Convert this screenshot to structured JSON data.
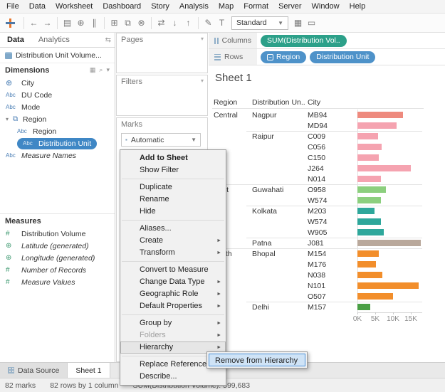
{
  "menu_bar": {
    "items": [
      "File",
      "Data",
      "Worksheet",
      "Dashboard",
      "Story",
      "Analysis",
      "Map",
      "Format",
      "Server",
      "Window",
      "Help"
    ]
  },
  "toolbar": {
    "icons": [
      {
        "name": "back-icon",
        "glyph": "←"
      },
      {
        "name": "forward-icon",
        "glyph": "→"
      },
      {
        "name": "save-icon",
        "glyph": "▤"
      },
      {
        "name": "add-data-source-icon",
        "glyph": "⊕"
      },
      {
        "name": "pause-updates-icon",
        "glyph": "∥"
      },
      {
        "name": "new-worksheet-icon",
        "glyph": "⊞"
      },
      {
        "name": "duplicate-icon",
        "glyph": "⧉"
      },
      {
        "name": "clear-sheet-icon",
        "glyph": "⊗"
      },
      {
        "name": "swap-icon",
        "glyph": "⇄"
      },
      {
        "name": "sort-ascending-icon",
        "glyph": "↓"
      },
      {
        "name": "sort-descending-icon",
        "glyph": "↑"
      },
      {
        "name": "highlight-icon",
        "glyph": "✎"
      },
      {
        "name": "show-labels-icon",
        "glyph": "T"
      }
    ],
    "fit_selector": "Standard",
    "right_icons": [
      {
        "name": "show-me-icon",
        "glyph": "▦"
      },
      {
        "name": "presentation-mode-icon",
        "glyph": "▭"
      }
    ]
  },
  "left_panel": {
    "tabs": [
      {
        "label": "Data"
      },
      {
        "label": "Analytics"
      }
    ],
    "data_source": "Distribution Unit Volume...",
    "dimensions": {
      "header": "Dimensions",
      "items": [
        {
          "icon": "globe",
          "label": "City",
          "indent": 0
        },
        {
          "icon": "abc",
          "label": "DU Code",
          "indent": 0
        },
        {
          "icon": "abc",
          "label": "Mode",
          "indent": 0
        },
        {
          "icon": "hierarchy",
          "label": "Region",
          "indent": 0
        },
        {
          "icon": "abc",
          "label": "Region",
          "indent": 1
        },
        {
          "icon": "abc",
          "label": "Distribution Unit",
          "indent": 1,
          "selected": true
        },
        {
          "icon": "abc",
          "label": "Measure Names",
          "indent": 0,
          "italic": true
        }
      ]
    },
    "measures": {
      "header": "Measures",
      "items": [
        {
          "icon": "number",
          "label": "Distribution Volume"
        },
        {
          "icon": "geo",
          "label": "Latitude (generated)",
          "italic": true
        },
        {
          "icon": "geo",
          "label": "Longitude (generated)",
          "italic": true
        },
        {
          "icon": "number",
          "label": "Number of Records",
          "italic": true
        },
        {
          "icon": "number",
          "label": "Measure Values",
          "italic": true
        }
      ]
    }
  },
  "cards": {
    "pages_label": "Pages",
    "filters_label": "Filters",
    "marks_label": "Marks",
    "marks_type": "Automatic"
  },
  "shelves": {
    "columns_label": "Columns",
    "columns_pills": [
      {
        "label": "SUM(Distribution Vol..",
        "color": "#2ca089"
      }
    ],
    "rows_label": "Rows",
    "rows_pills": [
      {
        "label": "Region",
        "color": "#4e92c9",
        "collapse": true
      },
      {
        "label": "Distribution Unit",
        "color": "#4e92c9"
      }
    ]
  },
  "sheet": {
    "title": "Sheet 1",
    "headers": [
      "Region",
      "Distribution Un..",
      "City"
    ]
  },
  "chart_data": {
    "type": "bar",
    "orientation": "horizontal",
    "title": "Sheet 1",
    "x_axis": {
      "ticks": [
        "0K",
        "5K",
        "10K",
        "15K"
      ],
      "tick_values": [
        0,
        5000,
        10000,
        15000
      ],
      "max": 19000
    },
    "rows": [
      {
        "region": "Central",
        "unit": "Nagpur",
        "city": "MB94",
        "value": 12.8,
        "color": "#ee8a7e",
        "sep": "none"
      },
      {
        "region": "",
        "unit": "",
        "city": "MD94",
        "value": 11.0,
        "color": "#f5a3b0",
        "sep": "none"
      },
      {
        "region": "",
        "unit": "Raipur",
        "city": "C009",
        "value": 5.8,
        "color": "#f5a3b0",
        "sep": "unit"
      },
      {
        "region": "",
        "unit": "",
        "city": "C056",
        "value": 6.8,
        "color": "#f5a3b0",
        "sep": "none"
      },
      {
        "region": "",
        "unit": "",
        "city": "C150",
        "value": 6.0,
        "color": "#f5a3b0",
        "sep": "none"
      },
      {
        "region": "",
        "unit": "",
        "city": "J264",
        "value": 15.0,
        "color": "#f5a3b0",
        "sep": "none"
      },
      {
        "region": "",
        "unit": "",
        "city": "N014",
        "value": 6.6,
        "color": "#f5a3b0",
        "sep": "none"
      },
      {
        "region": "East",
        "unit": "Guwahati",
        "city": "O958",
        "value": 8.0,
        "color": "#8ccf7e",
        "sep": "region"
      },
      {
        "region": "",
        "unit": "",
        "city": "W574",
        "value": 6.6,
        "color": "#8ccf7e",
        "sep": "none"
      },
      {
        "region": "",
        "unit": "Kolkata",
        "city": "M203",
        "value": 4.8,
        "color": "#2ea79b",
        "sep": "unit"
      },
      {
        "region": "",
        "unit": "",
        "city": "W574",
        "value": 6.6,
        "color": "#2ea79b",
        "sep": "none"
      },
      {
        "region": "",
        "unit": "",
        "city": "W905",
        "value": 7.4,
        "color": "#2ea79b",
        "sep": "none"
      },
      {
        "region": "",
        "unit": "Patna",
        "city": "J081",
        "value": 17.8,
        "color": "#b9a89b",
        "sep": "unit"
      },
      {
        "region": "North",
        "unit": "Bhopal",
        "city": "M154",
        "value": 6.0,
        "color": "#f28e2b",
        "sep": "region"
      },
      {
        "region": "",
        "unit": "",
        "city": "M176",
        "value": 5.2,
        "color": "#f28e2b",
        "sep": "none"
      },
      {
        "region": "",
        "unit": "",
        "city": "N038",
        "value": 7.0,
        "color": "#f28e2b",
        "sep": "none"
      },
      {
        "region": "",
        "unit": "",
        "city": "N101",
        "value": 17.2,
        "color": "#f28e2b",
        "sep": "none"
      },
      {
        "region": "",
        "unit": "",
        "city": "O507",
        "value": 10.0,
        "color": "#f28e2b",
        "sep": "none"
      },
      {
        "region": "",
        "unit": "Delhi",
        "city": "M157",
        "value": 3.6,
        "color": "#4a9f45",
        "sep": "unit"
      }
    ],
    "value_unit": "thousands"
  },
  "context_menu": {
    "items": [
      {
        "label": "Add to Sheet",
        "bold": true
      },
      {
        "label": "Show Filter"
      },
      {
        "type": "separator"
      },
      {
        "label": "Duplicate"
      },
      {
        "label": "Rename"
      },
      {
        "label": "Hide"
      },
      {
        "type": "separator"
      },
      {
        "label": "Aliases..."
      },
      {
        "label": "Create",
        "submenu": true
      },
      {
        "label": "Transform",
        "submenu": true
      },
      {
        "type": "separator"
      },
      {
        "label": "Convert to Measure"
      },
      {
        "label": "Change Data Type",
        "submenu": true
      },
      {
        "label": "Geographic Role",
        "submenu": true
      },
      {
        "label": "Default Properties",
        "submenu": true
      },
      {
        "type": "separator"
      },
      {
        "label": "Group by",
        "submenu": true
      },
      {
        "label": "Folders",
        "submenu": true,
        "disabled": true
      },
      {
        "label": "Hierarchy",
        "submenu": true,
        "highlighted": true
      },
      {
        "type": "separator"
      },
      {
        "label": "Replace References..."
      },
      {
        "label": "Describe..."
      }
    ],
    "submenu": {
      "items": [
        {
          "label": "Remove from Hierarchy",
          "highlighted": true
        }
      ]
    }
  },
  "bottom_tabs": [
    {
      "label": "Data Source",
      "active": false
    },
    {
      "label": "Sheet 1",
      "active": true
    }
  ],
  "status_bar": {
    "marks": "82 marks",
    "rows": "82 rows by 1 column",
    "aggregate": "SUM(Distribution Volume): 599,683"
  }
}
